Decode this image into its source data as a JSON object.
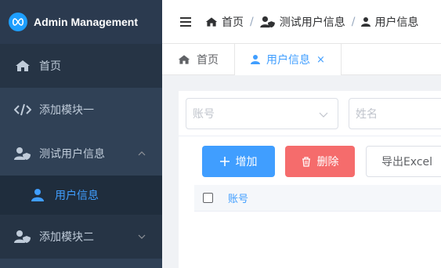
{
  "app": {
    "title": "Admin Management"
  },
  "sidebar": {
    "items": [
      {
        "label": "首页",
        "icon": "home-icon"
      },
      {
        "label": "添加模块一",
        "icon": "code-icon"
      },
      {
        "label": "测试用户信息",
        "icon": "user-shield-icon",
        "expanded": true,
        "children": [
          {
            "label": "用户信息",
            "icon": "user-icon",
            "active": true
          }
        ]
      },
      {
        "label": "添加模块二",
        "icon": "user-shield-icon",
        "expanded": false
      }
    ]
  },
  "breadcrumb": {
    "items": [
      "首页",
      "测试用户信息",
      "用户信息"
    ],
    "separator": "/"
  },
  "tabs": [
    {
      "label": "首页",
      "icon": "home-icon",
      "active": false
    },
    {
      "label": "用户信息",
      "icon": "user-icon",
      "active": true,
      "close": "×"
    }
  ],
  "filters": {
    "account_placeholder": "账号",
    "name_placeholder": "姓名"
  },
  "toolbar": {
    "add_label": "增加",
    "delete_label": "删除",
    "export_label": "导出Excel"
  },
  "table": {
    "columns": [
      "账号"
    ]
  },
  "colors": {
    "accent": "#409eff",
    "danger": "#f56c6c",
    "sidebar": "#304156"
  }
}
